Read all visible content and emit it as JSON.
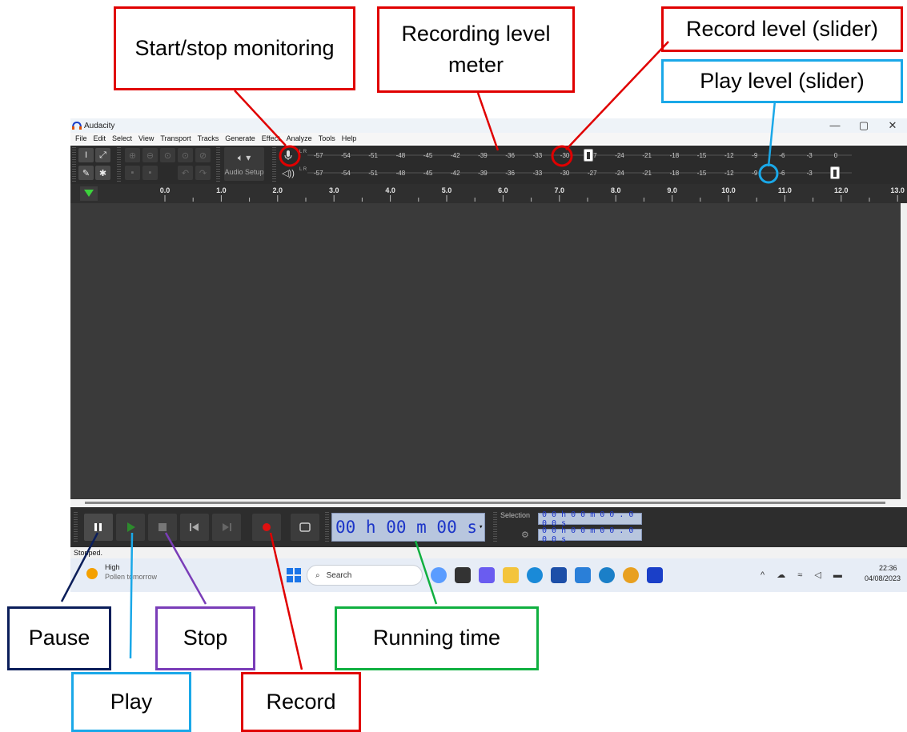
{
  "annotations": {
    "start_stop_monitoring": "Start/stop monitoring",
    "recording_level_meter": "Recording level meter",
    "record_level_slider": "Record level (slider)",
    "play_level_slider": "Play level (slider)",
    "pause": "Pause",
    "play": "Play",
    "stop": "Stop",
    "running_time": "Running time",
    "record": "Record"
  },
  "window": {
    "title": "Audacity",
    "minimize": "—",
    "maximize": "▢",
    "close": "✕"
  },
  "menu": [
    "File",
    "Edit",
    "Select",
    "View",
    "Transport",
    "Tracks",
    "Generate",
    "Effect",
    "Analyze",
    "Tools",
    "Help"
  ],
  "audio_setup": {
    "label": "Audio Setup"
  },
  "meter": {
    "ticks": [
      "-57",
      "-54",
      "-51",
      "-48",
      "-45",
      "-42",
      "-39",
      "-36",
      "-33",
      "-30",
      "-27",
      "-24",
      "-21",
      "-18",
      "-15",
      "-12",
      "-9",
      "-6",
      "-3",
      "0"
    ],
    "channels": "L R",
    "record_level_db": -27,
    "play_level_db": 0
  },
  "ruler": {
    "ticks": [
      "0.0",
      "1.0",
      "2.0",
      "3.0",
      "4.0",
      "5.0",
      "6.0",
      "7.0",
      "8.0",
      "9.0",
      "10.0",
      "11.0",
      "12.0",
      "13.0"
    ]
  },
  "transport": {
    "running_time": "00 h 00 m 00 s",
    "selection_label": "Selection",
    "selection_start": "0 0 h 0 0 m 0 0 . 0 0 0 s",
    "selection_end": "0 0 h 0 0 m 0 0 . 0 0 0 s",
    "colors": {
      "record": "#e01010",
      "play": "#2d8a2d"
    }
  },
  "status": {
    "text": "Stopped."
  },
  "taskbar": {
    "weather_title": "High",
    "weather_subtitle": "Pollen tomorrow",
    "search_placeholder": "Search",
    "time": "22:36",
    "date": "04/08/2023"
  }
}
